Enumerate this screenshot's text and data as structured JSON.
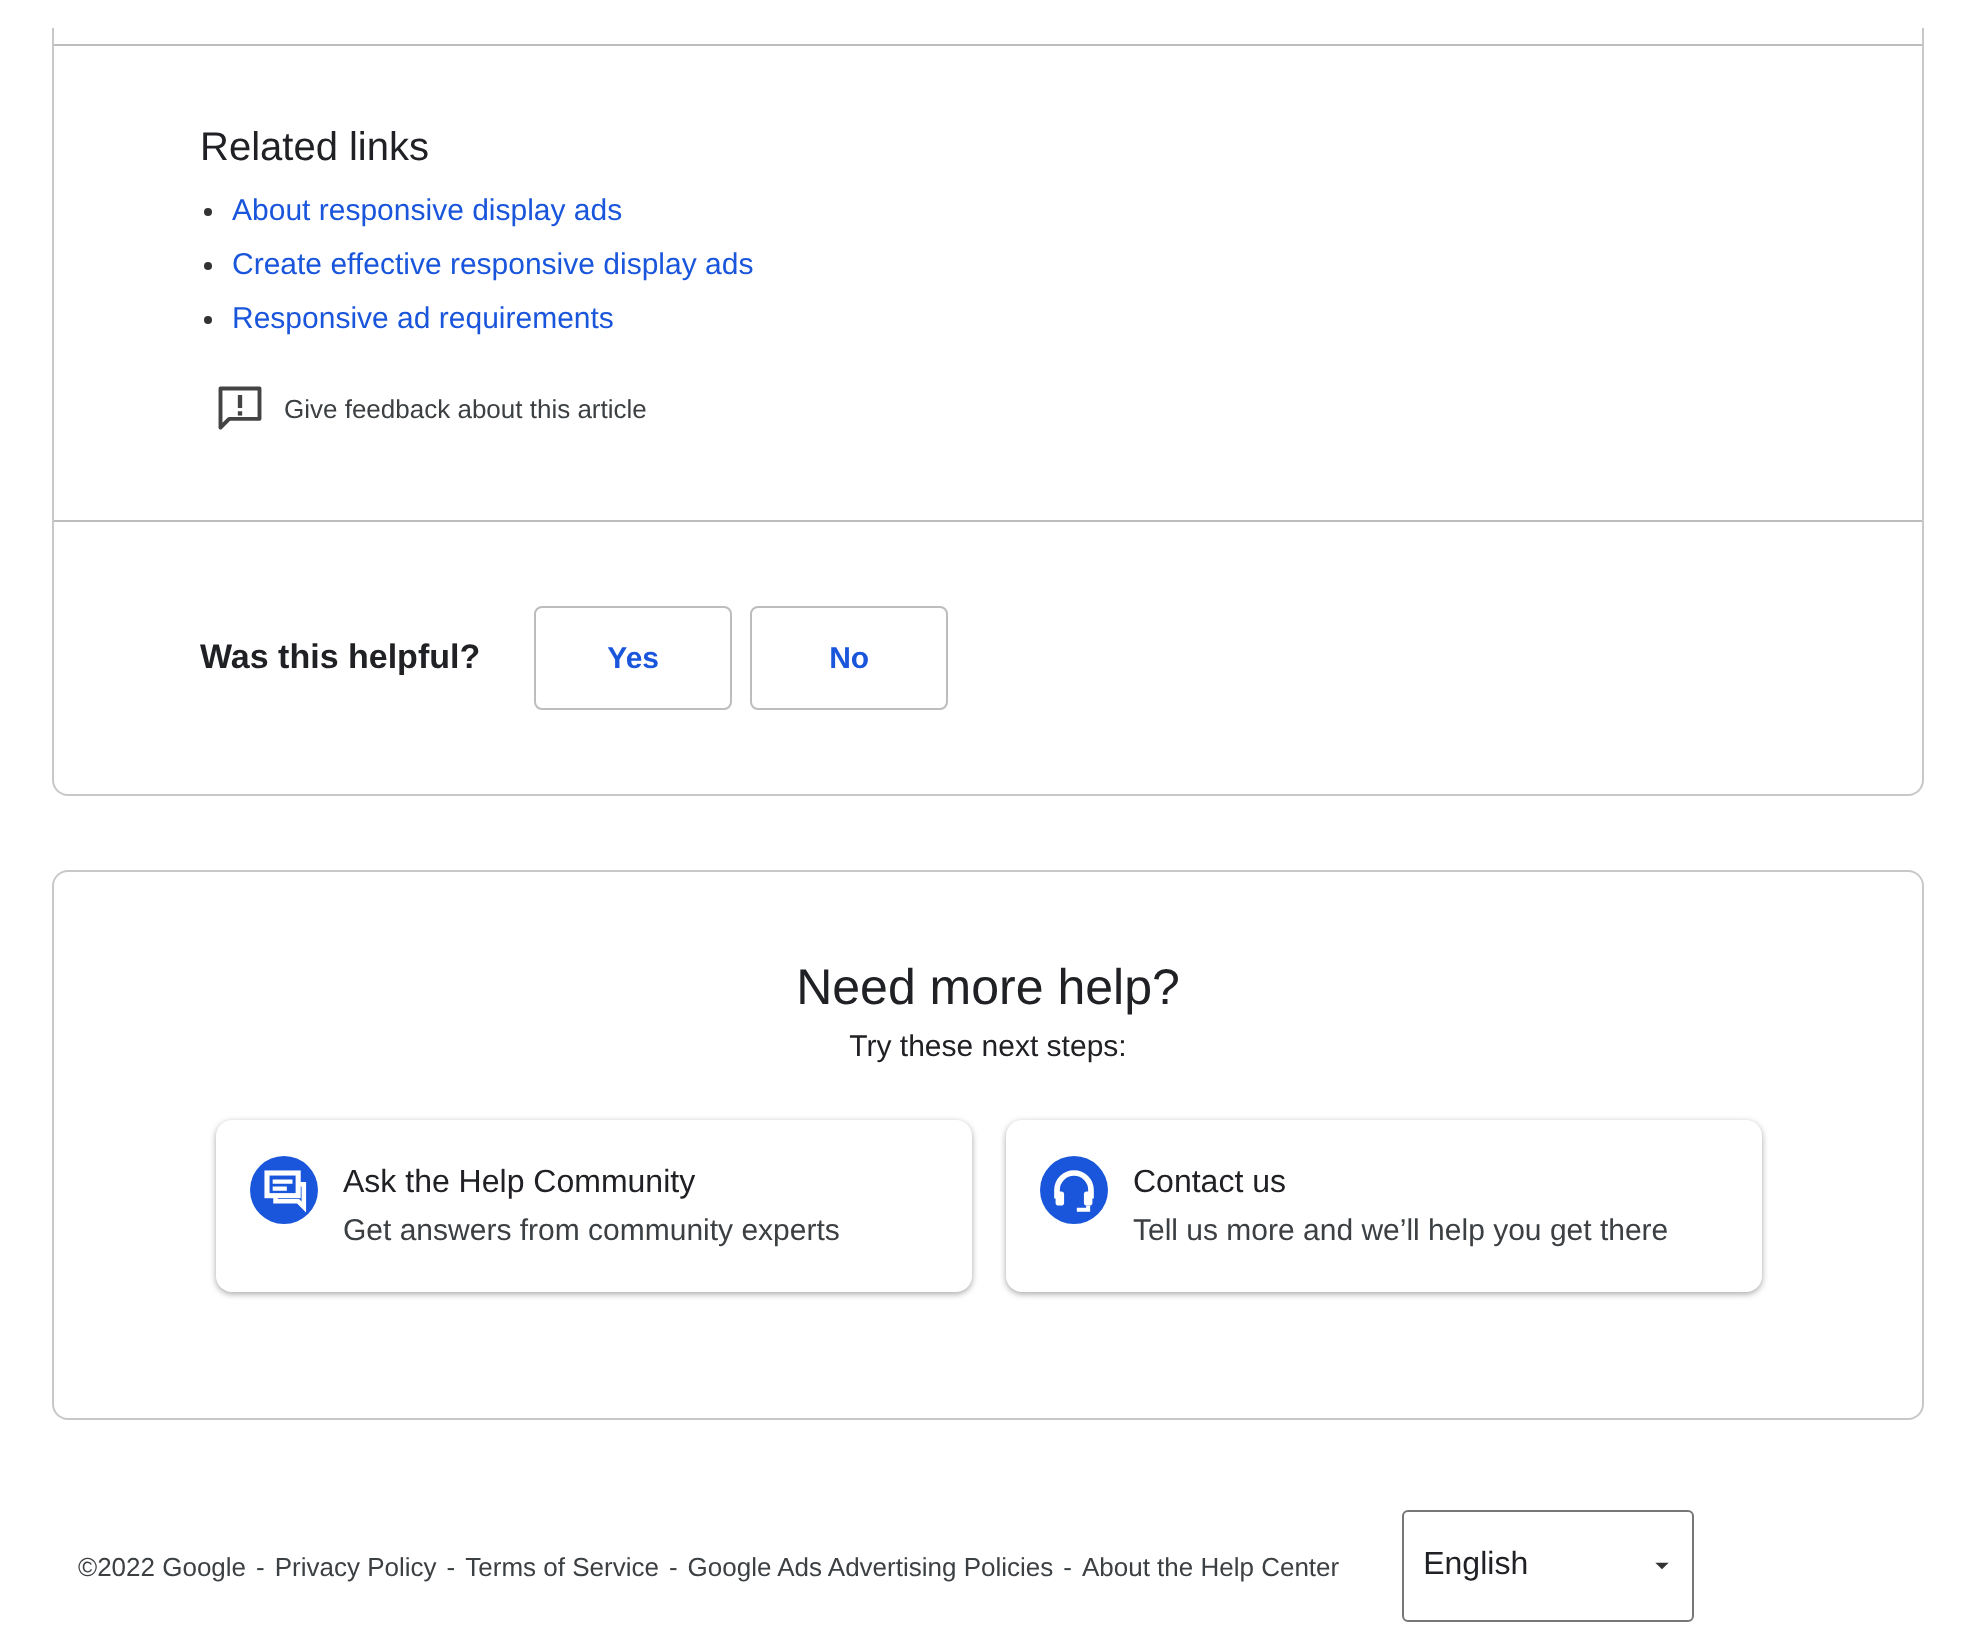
{
  "related_links": {
    "title": "Related links",
    "links": [
      {
        "label": "About responsive display ads"
      },
      {
        "label": "Create effective responsive display ads"
      },
      {
        "label": "Responsive ad requirements"
      }
    ],
    "feedback": "Give feedback about this article"
  },
  "helpful": {
    "question": "Was this helpful?",
    "buttons": [
      "Yes",
      "No"
    ]
  },
  "more_help": {
    "title": "Need more help?",
    "subtitle": "Try these next steps:",
    "options": [
      {
        "kind": "community",
        "title": "Ask the Help Community",
        "description": "Get answers from community experts"
      },
      {
        "kind": "contact",
        "title": "Contact us",
        "description": "Tell us more and we’ll help you get there"
      }
    ]
  },
  "footer": {
    "items": [
      "©2022 Google",
      "Privacy Policy",
      "Terms of Service",
      "Google Ads Advertising Policies",
      "About the Help Center"
    ],
    "separator": "-",
    "language": "English"
  }
}
